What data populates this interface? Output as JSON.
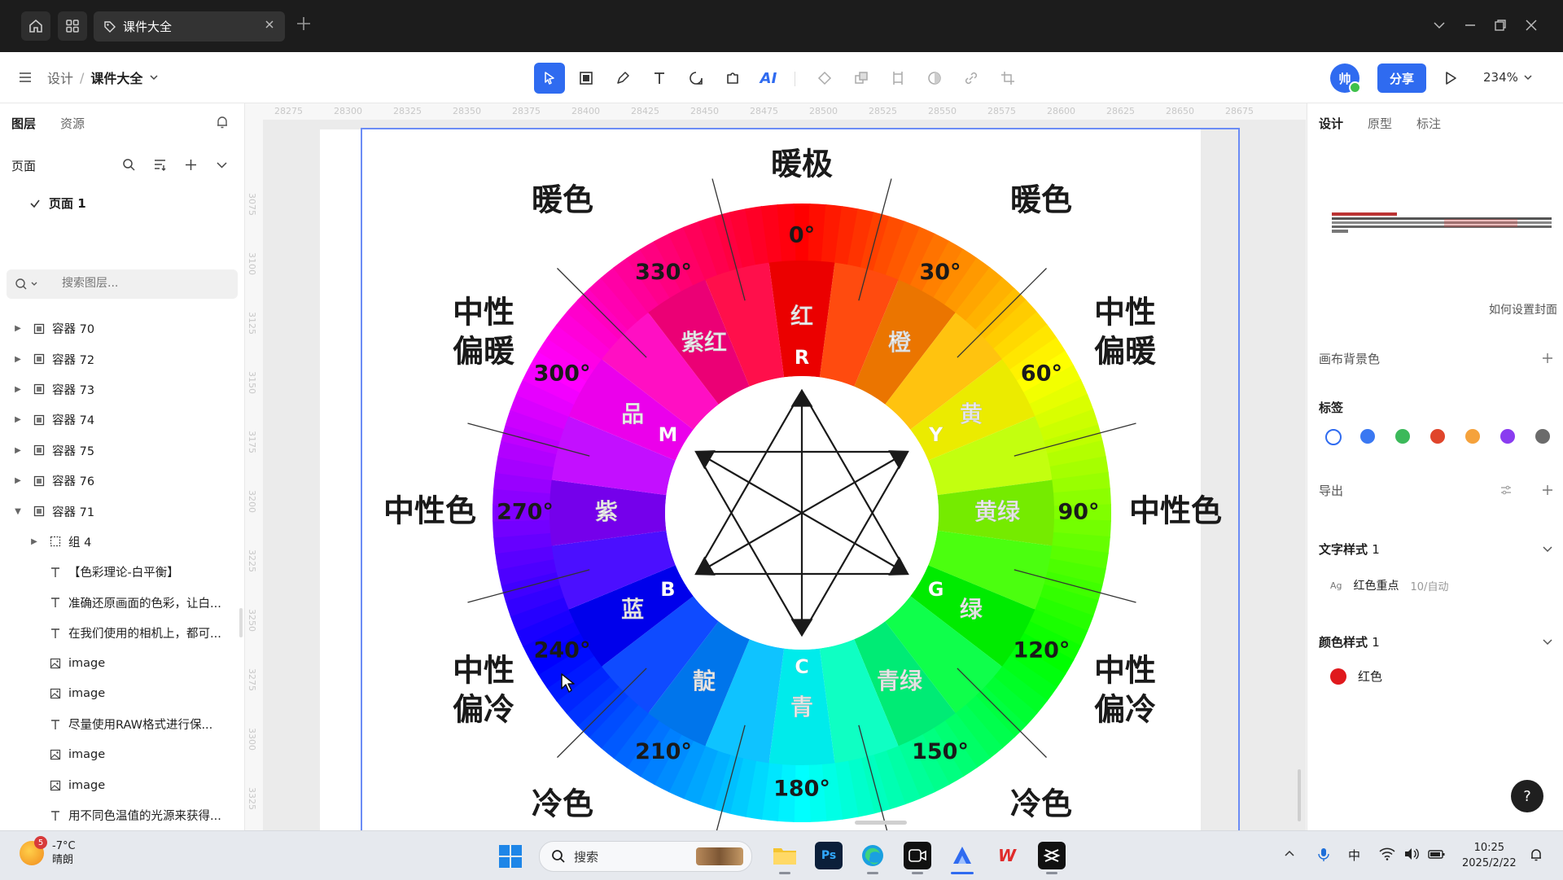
{
  "titlebar": {
    "tab_title": "课件大全"
  },
  "toolbar": {
    "breadcrumb_parent": "设计",
    "breadcrumb_sep": "/",
    "breadcrumb_current": "课件大全",
    "ai_label": "AI",
    "avatar_text": "帅",
    "share_label": "分享",
    "zoom_level": "234%"
  },
  "left_panel": {
    "tab_layers": "图层",
    "tab_assets": "资源",
    "pages_label": "页面",
    "page_name": "页面 1",
    "search_placeholder": "搜索图层...",
    "layers": [
      {
        "name": "容器 70",
        "type": "frame",
        "expanded": false,
        "indent": 0
      },
      {
        "name": "容器 72",
        "type": "frame",
        "expanded": false,
        "indent": 0
      },
      {
        "name": "容器 73",
        "type": "frame",
        "expanded": false,
        "indent": 0
      },
      {
        "name": "容器 74",
        "type": "frame",
        "expanded": false,
        "indent": 0
      },
      {
        "name": "容器 75",
        "type": "frame",
        "expanded": false,
        "indent": 0
      },
      {
        "name": "容器 76",
        "type": "frame",
        "expanded": false,
        "indent": 0
      },
      {
        "name": "容器 71",
        "type": "frame",
        "expanded": true,
        "indent": 0
      },
      {
        "name": "组 4",
        "type": "group",
        "expanded": false,
        "indent": 1
      },
      {
        "name": "【色彩理论-白平衡】",
        "type": "text",
        "indent": 1
      },
      {
        "name": "准确还原画面的色彩，让白...",
        "type": "text",
        "indent": 1
      },
      {
        "name": "在我们使用的相机上，都可...",
        "type": "text",
        "indent": 1
      },
      {
        "name": "image",
        "type": "image",
        "indent": 1
      },
      {
        "name": "image",
        "type": "image",
        "indent": 1
      },
      {
        "name": "尽量使用RAW格式进行保...",
        "type": "text",
        "indent": 1
      },
      {
        "name": "image",
        "type": "image",
        "indent": 1
      },
      {
        "name": "image",
        "type": "image",
        "indent": 1
      },
      {
        "name": "用不同色温值的光源来获得...",
        "type": "text",
        "indent": 1
      }
    ]
  },
  "ruler": {
    "top": [
      "28275",
      "28300",
      "28325",
      "28350",
      "28375",
      "28400",
      "28425",
      "28450",
      "28475",
      "28500",
      "28525",
      "28550",
      "28575",
      "28600",
      "28625",
      "28650",
      "28675"
    ],
    "left": [
      "3075",
      "3100",
      "3125",
      "3150",
      "3175",
      "3200",
      "3225",
      "3250",
      "3275",
      "3300",
      "3325"
    ]
  },
  "color_wheel": {
    "zones": {
      "warm_pole": "暖极",
      "warm_left": "暖色",
      "warm_right": "暖色",
      "neutral_warm_left": [
        "中性",
        "偏暖"
      ],
      "neutral_warm_right": [
        "中性",
        "偏暖"
      ],
      "neutral_left": "中性色",
      "neutral_right": "中性色",
      "neutral_cool_left": [
        "中性",
        "偏冷"
      ],
      "neutral_cool_right": [
        "中性",
        "偏冷"
      ],
      "cool_left": "冷色",
      "cool_right": "冷色"
    },
    "degrees": [
      "0°",
      "30°",
      "60°",
      "90°",
      "120°",
      "150°",
      "180°",
      "210°",
      "240°",
      "270°",
      "300°",
      "330°"
    ],
    "hue_names": [
      "红",
      "橙",
      "黄",
      "黄绿",
      "绿",
      "青绿",
      "青",
      "靛",
      "蓝",
      "紫",
      "品",
      "紫红"
    ],
    "primaries": [
      "R",
      "Y",
      "G",
      "C",
      "B",
      "M"
    ],
    "colors": {
      "red": "#e60012",
      "yellow": "#ffff00",
      "green": "#00c800",
      "cyan": "#00ffff",
      "blue": "#0000ff",
      "magenta": "#ff00ff"
    }
  },
  "right_panel": {
    "tab_design": "设计",
    "tab_prototype": "原型",
    "tab_annotate": "标注",
    "cover_link": "如何设置封面",
    "canvas_bg_label": "画布背景色",
    "tags_label": "标签",
    "tag_colors": [
      "#ffffff",
      "#3a78f2",
      "#3cb95a",
      "#e0452b",
      "#f5a23c",
      "#8a3cf0",
      "#6b6b6b"
    ],
    "export_label": "导出",
    "text_style_label": "文字样式",
    "text_style_count": "1",
    "text_style_ag": "Ag",
    "text_style_name": "红色重点",
    "text_style_meta": "10/自动",
    "color_style_label": "颜色样式",
    "color_style_count": "1",
    "color_style_name": "红色",
    "color_style_hex": "#e0191d",
    "help_label": "?"
  },
  "taskbar": {
    "weather_badge": "5",
    "weather_temp": "-7°C",
    "weather_desc": "晴朗",
    "search_label": "搜索",
    "app_ps": "Ps",
    "app_wps": "W",
    "ime": "中",
    "time": "10:25",
    "date": "2025/2/22"
  }
}
